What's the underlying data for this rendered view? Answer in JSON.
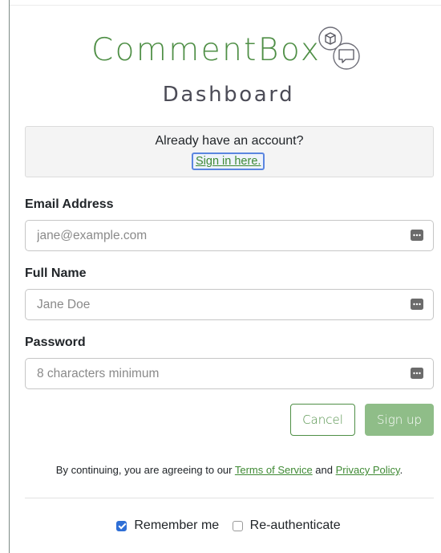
{
  "brand": {
    "logo_text": "CommentBox",
    "subtitle": "Dashboard",
    "color": "#4f8f46"
  },
  "signin_notice": {
    "text": "Already have an account?",
    "link_label": "Sign in here."
  },
  "form": {
    "email": {
      "label": "Email Address",
      "placeholder": "jane@example.com",
      "value": ""
    },
    "full_name": {
      "label": "Full Name",
      "placeholder": "Jane Doe",
      "value": ""
    },
    "password": {
      "label": "Password",
      "placeholder": "8 characters minimum",
      "value": ""
    },
    "cancel_label": "Cancel",
    "signup_label": "Sign up",
    "primary_color": "#8fbd88"
  },
  "terms": {
    "prefix": "By continuing, you are agreeing to our ",
    "tos_label": "Terms of Service",
    "conjunction": " and ",
    "privacy_label": "Privacy Policy",
    "suffix": "."
  },
  "options": {
    "remember_me": {
      "label": "Remember me",
      "checked": true
    },
    "reauthenticate": {
      "label": "Re-authenticate",
      "checked": false
    }
  },
  "icons": {
    "field_trailing": "keyboard-icon",
    "logo": "cube-and-chat-bubble-icon"
  }
}
